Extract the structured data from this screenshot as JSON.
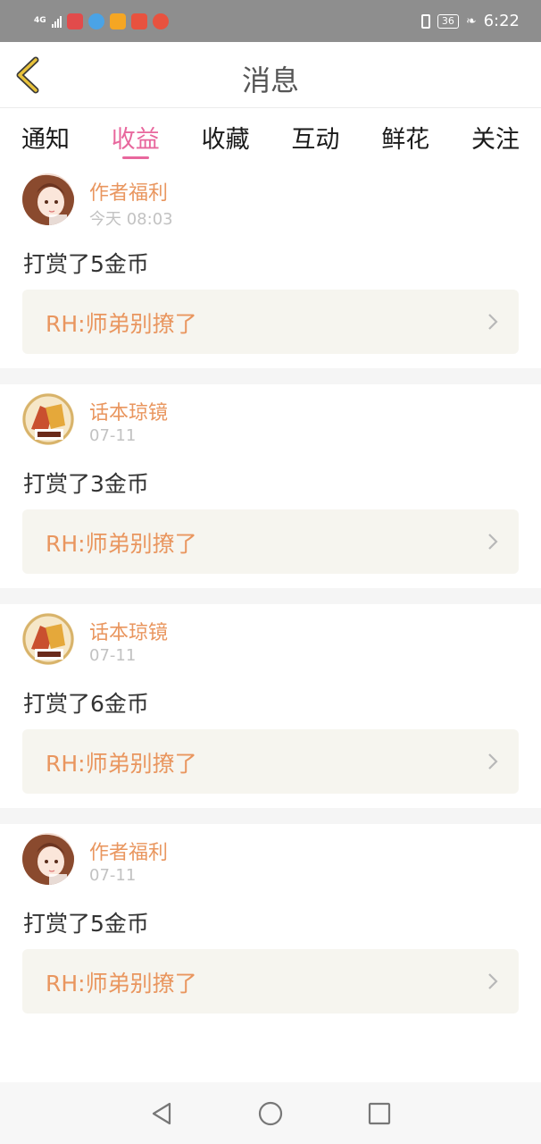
{
  "status_bar": {
    "network": "4G",
    "time": "6:22",
    "battery": "36",
    "app_icon_colors": [
      "#e24b4b",
      "#4aa3e6",
      "#f5a623",
      "#e8523f",
      "#e8523f"
    ]
  },
  "header": {
    "title": "消息",
    "back_icon": "chevron-left-icon",
    "accent": "#e8c23b"
  },
  "tabs": [
    {
      "label": "通知",
      "active": false
    },
    {
      "label": "收益",
      "active": true
    },
    {
      "label": "收藏",
      "active": false
    },
    {
      "label": "互动",
      "active": false
    },
    {
      "label": "鲜花",
      "active": false
    },
    {
      "label": "关注",
      "active": false
    }
  ],
  "messages": [
    {
      "sender": "作者福利",
      "time": "今天 08:03",
      "text": "打赏了5金币",
      "ref": "RH:师弟别撩了",
      "avatar": "anime-girl"
    },
    {
      "sender": "话本琼镜",
      "time": "07-11",
      "text": "打赏了3金币",
      "ref": "RH:师弟别撩了",
      "avatar": "book-logo"
    },
    {
      "sender": "话本琼镜",
      "time": "07-11",
      "text": "打赏了6金币",
      "ref": "RH:师弟别撩了",
      "avatar": "book-logo"
    },
    {
      "sender": "作者福利",
      "time": "07-11",
      "text": "打赏了5金币",
      "ref": "RH:师弟别撩了",
      "avatar": "anime-girl"
    }
  ],
  "colors": {
    "tab_active": "#e8679d",
    "sender": "#e9965f",
    "ref_bg": "#f6f5ef"
  },
  "nav": {
    "back": "triangle-back-icon",
    "home": "circle-home-icon",
    "recents": "square-recents-icon"
  }
}
